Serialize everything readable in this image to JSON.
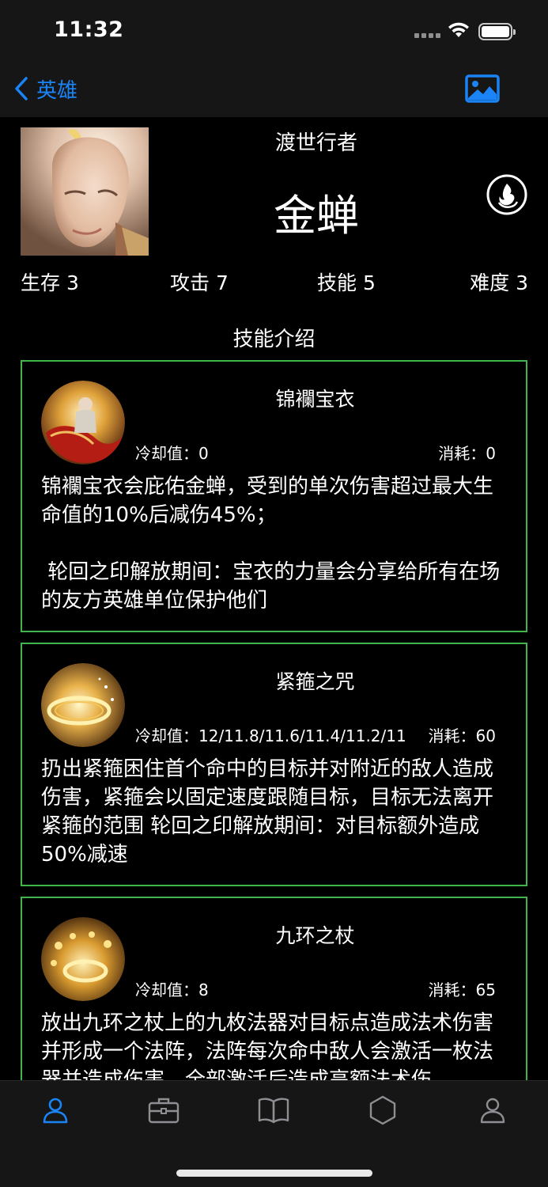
{
  "status_bar": {
    "time": "11:32",
    "icons": [
      "signal-icon",
      "wifi-icon",
      "battery-icon"
    ]
  },
  "nav": {
    "back_label": "英雄",
    "back_icon": "chevron-left-icon",
    "right_icon": "photo-gallery-icon",
    "accent_color": "#1a84f6"
  },
  "hero": {
    "subtitle": "渡世行者",
    "name": "金蝉",
    "portrait_icon": "hero-portrait",
    "class_icon": "flame-icon",
    "stats": [
      {
        "label": "生存 3"
      },
      {
        "label": "攻击 7"
      },
      {
        "label": "技能 5"
      },
      {
        "label": "难度 3"
      }
    ]
  },
  "skills_section": {
    "title": "技能介绍",
    "border_color": "#3fb54c",
    "skills": [
      {
        "name": "锦襴宝衣",
        "cooldown": "冷却值：0",
        "cost": "消耗：0",
        "description": "锦襴宝衣会庇佑金蝉，受到的单次伤害超过最大生命值的10%后减伤45%；\n\n 轮回之印解放期间：宝衣的力量会分享给所有在场的友方英雄单位保护他们"
      },
      {
        "name": "紧箍之咒",
        "cooldown": "冷却值：12/11.8/11.6/11.4/11.2/11",
        "cost": "消耗：60",
        "description": "扔出紧箍困住首个命中的目标并对附近的敌人造成伤害，紧箍会以固定速度跟随目标，目标无法离开紧箍的范围 轮回之印解放期间：对目标额外造成50%减速"
      },
      {
        "name": "九环之杖",
        "cooldown": "冷却值：8",
        "cost": "消耗：65",
        "description": "放出九环之杖上的九枚法器对目标点造成法术伤害并形成一个法阵，法阵每次命中敌人会激活一枚法器并造成伤害，全部激活后造成高额法术伤"
      }
    ]
  },
  "tab_bar": {
    "active_color": "#1a84f6",
    "inactive_color": "#8e8e93",
    "tabs": [
      {
        "icon": "person-icon",
        "active": true
      },
      {
        "icon": "briefcase-icon",
        "active": false
      },
      {
        "icon": "book-icon",
        "active": false
      },
      {
        "icon": "hexagon-icon",
        "active": false
      },
      {
        "icon": "profile-icon",
        "active": false
      }
    ]
  }
}
